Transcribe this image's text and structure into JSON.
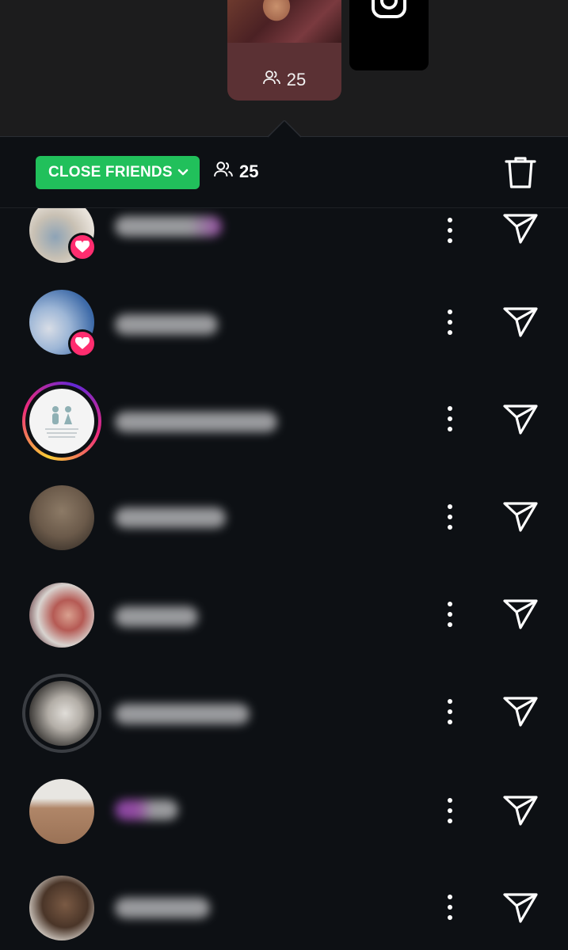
{
  "story": {
    "viewer_count": "25"
  },
  "header": {
    "audience_label": "CLOSE FRIENDS",
    "viewer_count": "25"
  },
  "viewers": [
    {
      "name": "",
      "badge": "heart"
    },
    {
      "name": "",
      "badge": "heart"
    },
    {
      "name": "",
      "badge": "story-ring"
    },
    {
      "name": "",
      "badge": "none"
    },
    {
      "name": "",
      "badge": "none"
    },
    {
      "name": "",
      "badge": "seen-ring"
    },
    {
      "name": "",
      "badge": "none"
    },
    {
      "name": "",
      "badge": "none"
    }
  ],
  "colors": {
    "accent_green": "#21c05b",
    "heart_pink": "#ff2d6f",
    "background": "#0d1014"
  },
  "icons": {
    "viewers": "people-icon",
    "delete": "trash-icon",
    "more": "more-vertical-icon",
    "send": "send-icon",
    "camera": "instagram-camera-icon"
  }
}
